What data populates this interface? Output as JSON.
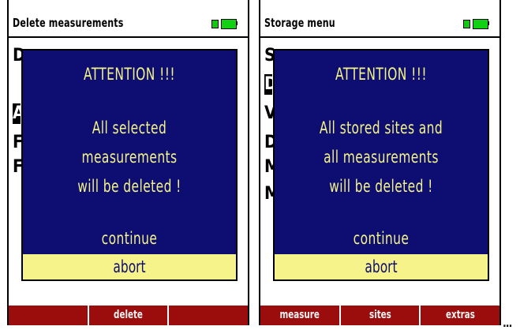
{
  "screens": [
    {
      "title": "Delete measurements",
      "dialog": {
        "heading": "ATTENTION !!!",
        "message": [
          "All selected",
          "measurements",
          "will be deleted !"
        ],
        "options": [
          "continue",
          "abort"
        ],
        "selected_option": "abort"
      },
      "softkeys": [
        "",
        "delete",
        ""
      ]
    },
    {
      "title": "Storage menu",
      "dialog": {
        "heading": "ATTENTION !!!",
        "message": [
          "All stored sites and",
          "all measurements",
          "will be deleted !"
        ],
        "options": [
          "continue",
          "abort"
        ],
        "selected_option": "abort"
      },
      "softkeys": [
        "measure",
        "sites",
        "extras"
      ]
    }
  ],
  "continuation": "..."
}
